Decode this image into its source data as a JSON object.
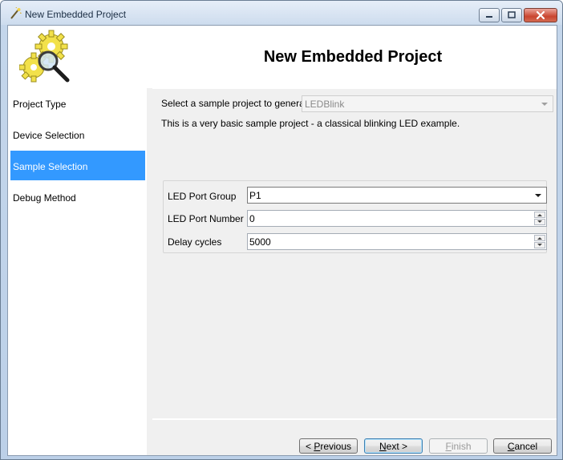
{
  "window": {
    "title": "New Embedded Project"
  },
  "header": {
    "title": "New Embedded Project"
  },
  "sidebar": {
    "items": [
      {
        "label": "Project Type"
      },
      {
        "label": "Device Selection"
      },
      {
        "label": "Sample Selection",
        "selected": true
      },
      {
        "label": "Debug Method"
      }
    ]
  },
  "sample": {
    "label": "Select a sample project to generate:",
    "value": "LEDBlink",
    "description": "This is a very basic sample project - a classical blinking LED example."
  },
  "properties": [
    {
      "label": "LED Port Group",
      "value": "P1",
      "kind": "dropdown"
    },
    {
      "label": "LED Port Number",
      "value": "0",
      "kind": "spinner"
    },
    {
      "label": "Delay cycles",
      "value": "5000",
      "kind": "spinner"
    }
  ],
  "buttons": {
    "previous_prefix": "< ",
    "previous_key": "P",
    "previous_rest": "revious",
    "next_key": "N",
    "next_rest": "ext >",
    "finish_key": "F",
    "finish_rest": "inish",
    "cancel_key": "C",
    "cancel_rest": "ancel"
  },
  "colors": {
    "selection": "#3399ff",
    "close_button": "#c9452f"
  }
}
